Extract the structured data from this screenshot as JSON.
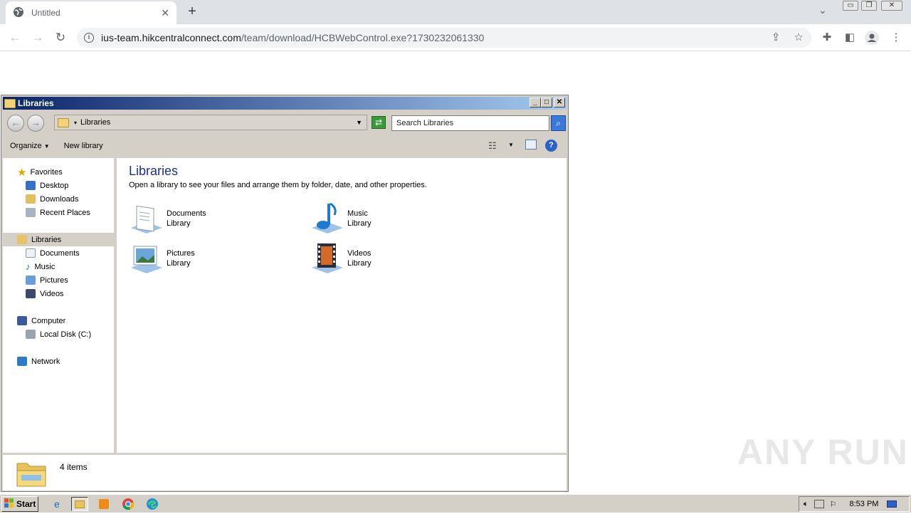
{
  "browser": {
    "tab_title": "Untitled",
    "url_host": "ius-team.hikcentralconnect.com",
    "url_path": "/team/download/HCBWebControl.exe?1730232061330"
  },
  "explorer": {
    "window_title": "Libraries",
    "address": "Libraries",
    "search_placeholder": "Search Libraries",
    "organize_label": "Organize",
    "new_library_label": "New library",
    "heading": "Libraries",
    "subheading": "Open a library to see your files and arrange them by folder, date, and other properties.",
    "nav": {
      "favorites": "Favorites",
      "desktop": "Desktop",
      "downloads": "Downloads",
      "recent": "Recent Places",
      "libraries": "Libraries",
      "documents": "Documents",
      "music": "Music",
      "pictures": "Pictures",
      "videos": "Videos",
      "computer": "Computer",
      "local_disk": "Local Disk (C:)",
      "network": "Network"
    },
    "libraries": [
      {
        "name": "Documents",
        "type": "Library",
        "icon": "documents-library-icon"
      },
      {
        "name": "Music",
        "type": "Library",
        "icon": "music-library-icon"
      },
      {
        "name": "Pictures",
        "type": "Library",
        "icon": "pictures-library-icon"
      },
      {
        "name": "Videos",
        "type": "Library",
        "icon": "videos-library-icon"
      }
    ],
    "item_count": "4 items"
  },
  "taskbar": {
    "start_label": "Start",
    "clock": "8:53 PM"
  },
  "watermark": "ANY RUN"
}
